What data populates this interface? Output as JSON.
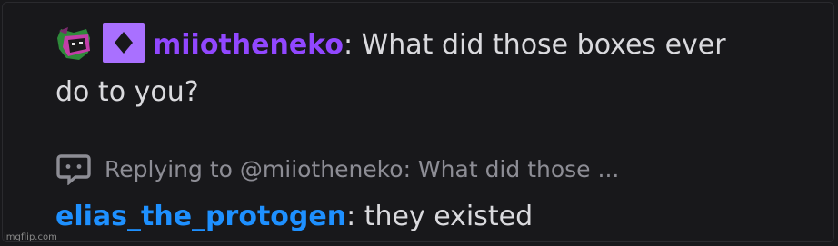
{
  "message": {
    "badges": [
      "protogen-avatar-badge-icon",
      "subscriber-badge-icon"
    ],
    "username": "miiotheneko",
    "separator": ":",
    "text": " What did those boxes ever do to you?",
    "username_color": "#9147ff"
  },
  "reply": {
    "icon": "reply-chat-icon",
    "label": "Replying to @miiotheneko: What did those ..."
  },
  "reply_message": {
    "username": "elias_the_protogen",
    "separator": ":",
    "text": " they existed",
    "username_color": "#1e90ff"
  },
  "watermark": "imgflip.com",
  "colors": {
    "background": "#18181b",
    "text": "#dadade",
    "muted": "#8d8d95",
    "badge_purple": "#a970ff"
  }
}
